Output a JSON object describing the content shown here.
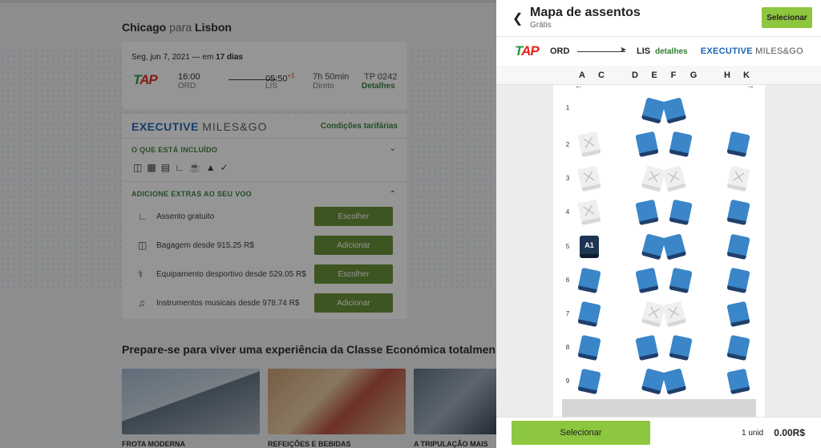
{
  "background": {
    "route": {
      "from": "Chicago",
      "para": "para",
      "to": "Lisbon"
    },
    "flight": {
      "date_prefix": "Seg, jun 7, 2021 — em ",
      "date_days": "17 dias",
      "depart_time": "16:00",
      "depart_code": "ORD",
      "arrive_time": "05:50",
      "arrive_plus": "+1",
      "arrive_code": "LIS",
      "duration": "7h 50min",
      "stops": "Direto",
      "flight_no": "TP 0242",
      "details": "Detalhes"
    },
    "fare": {
      "brand": "EXECUTIVE",
      "brand_suffix": "MILES&GO",
      "conditions": "Condições tarifárias",
      "included_title": "O QUE ESTÁ INCLUÍDO",
      "extras_title": "ADICIONE EXTRAS AO SEU VOO",
      "extras": [
        {
          "label": "Assento gratuito",
          "button": "Escolher",
          "icon": "seat-icon"
        },
        {
          "label": "Bagagem desde 915.25 R$",
          "button": "Adicionar",
          "icon": "baggage-icon"
        },
        {
          "label": "Equipamento desportivo desde 529.05 R$",
          "button": "Escolher",
          "icon": "bicycle-icon"
        },
        {
          "label": "Instrumentos musicais desde 978.74 R$",
          "button": "Adicionar",
          "icon": "guitar-icon"
        }
      ]
    },
    "prepare_title": "Prepare-se para viver uma experiência da Classe Económica totalmen",
    "thumbnails": [
      {
        "label": "FROTA MODERNA",
        "color": "#8aa3b8"
      },
      {
        "label": "REFEIÇÕES E BEBIDAS",
        "color": "#b9876a"
      },
      {
        "label": "A TRIPULAÇÃO MAIS",
        "color": "#6f8294"
      }
    ]
  },
  "panel": {
    "title": "Mapa de assentos",
    "subtitle": "Grátis",
    "select_top": "Selecionar",
    "origin": "ORD",
    "destination": "LIS",
    "details": "detalhes",
    "cabin_brand": "EXECUTIVE",
    "cabin_suffix": "MILES&GO",
    "columns": [
      "A",
      "C",
      "D",
      "E",
      "F",
      "G",
      "H",
      "K"
    ],
    "arrow_left": "←",
    "arrow_right": "→",
    "rows": [
      "1",
      "2",
      "3",
      "4",
      "5",
      "6",
      "7",
      "8",
      "9"
    ],
    "selected_seat": "A1",
    "footer_select": "Selecionar",
    "units": "1 unid",
    "price": "0.00R$"
  },
  "colors": {
    "available_seat": "#3a86c8",
    "selected_seat": "#1d3553",
    "green_button": "#8dc63f",
    "green_link": "#2e7d32",
    "brand_blue": "#1a5fb4"
  }
}
